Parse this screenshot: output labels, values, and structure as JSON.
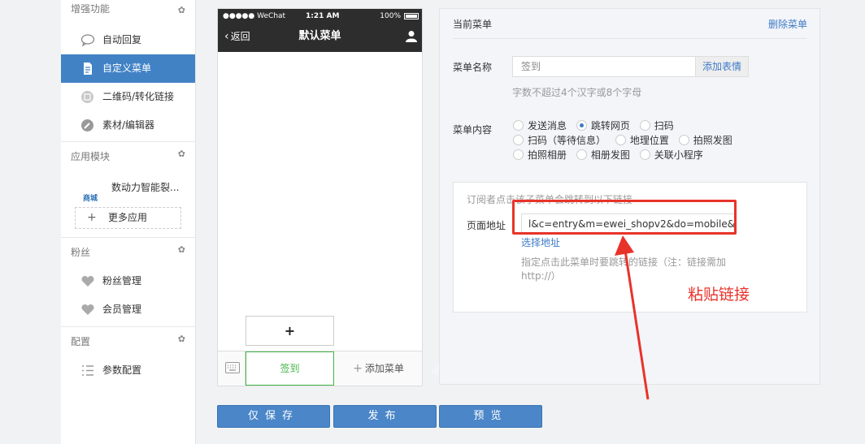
{
  "sidebar": {
    "sections": {
      "enhance": "增强功能",
      "apps": "应用模块",
      "fans": "粉丝",
      "config": "配置"
    },
    "items": {
      "auto_reply": "自动回复",
      "custom_menu": "自定义菜单",
      "qrcode": "二维码/转化链接",
      "material": "素材/编辑器",
      "app_name": "数动力智能裂...",
      "app_logo": "商城",
      "more_apps": "更多应用",
      "fan_manage": "粉丝管理",
      "member_manage": "会员管理",
      "param_config": "参数配置"
    }
  },
  "phone": {
    "carrier": "●●●●● WeChat",
    "time": "1:21 AM",
    "battery": "100%",
    "back": "返回",
    "title": "默认菜单",
    "add_sub": "+",
    "menu_item": "签到",
    "add_menu": "添加菜单"
  },
  "editor": {
    "title": "当前菜单",
    "delete": "删除菜单",
    "name_label": "菜单名称",
    "name_value": "签到",
    "emoji_button": "添加表情",
    "name_hint": "字数不超过4个汉字或8个字母",
    "content_label": "菜单内容",
    "options": [
      "发送消息",
      "跳转网页",
      "扫码",
      "扫码（等待信息）",
      "地理位置",
      "拍照发图",
      "拍照相册",
      "相册发图",
      "关联小程序"
    ],
    "selected_option": "跳转网页",
    "panel_hint": "订阅者点击该子菜单会跳转到以下链接",
    "url_label": "页面地址",
    "url_value": "l&c=entry&m=ewei_shopv2&do=mobile&",
    "select_url": "选择地址",
    "url_hint": "指定点击此菜单时要跳转的链接（注：链接需加http://）"
  },
  "annotation": {
    "text": "粘贴链接",
    "color": "#e8332a"
  },
  "buttons": {
    "save": "仅保存",
    "publish": "发布",
    "preview": "预览"
  },
  "colors": {
    "accent": "#4182c5",
    "green": "#44b549",
    "link": "#3d7bc7"
  }
}
